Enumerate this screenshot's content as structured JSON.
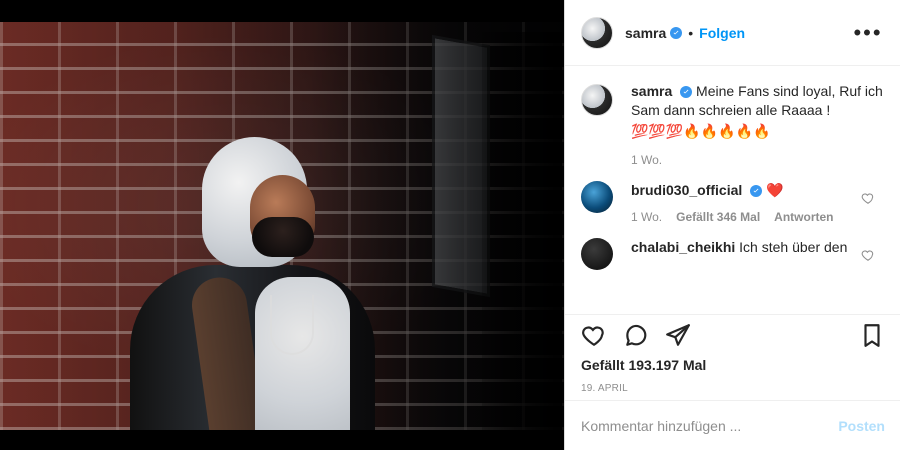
{
  "post": {
    "username": "samra",
    "follow_label": "Folgen",
    "more_label": "•••",
    "caption": {
      "username": "samra",
      "text": "Meine Fans sind loyal, Ruf ich Sam dann schreien alle Raaaa !",
      "emojis": "💯💯💯🔥🔥🔥🔥🔥",
      "time": "1 Wo."
    },
    "comments": [
      {
        "username": "brudi030_official",
        "text": "",
        "time": "1 Wo.",
        "likes": "Gefällt 346 Mal",
        "reply_label": "Antworten"
      },
      {
        "username": "chalabi_cheikhi",
        "text": "Ich steh über den"
      }
    ],
    "likes_text": "Gefällt 193.197 Mal",
    "date_text": "19. APRIL",
    "add_comment_placeholder": "Kommentar hinzufügen ...",
    "post_label": "Posten"
  },
  "colors": {
    "link_blue": "#0095f6",
    "verified_blue": "#3897f0",
    "muted_text": "#8e8e8e",
    "border": "#efefef"
  }
}
